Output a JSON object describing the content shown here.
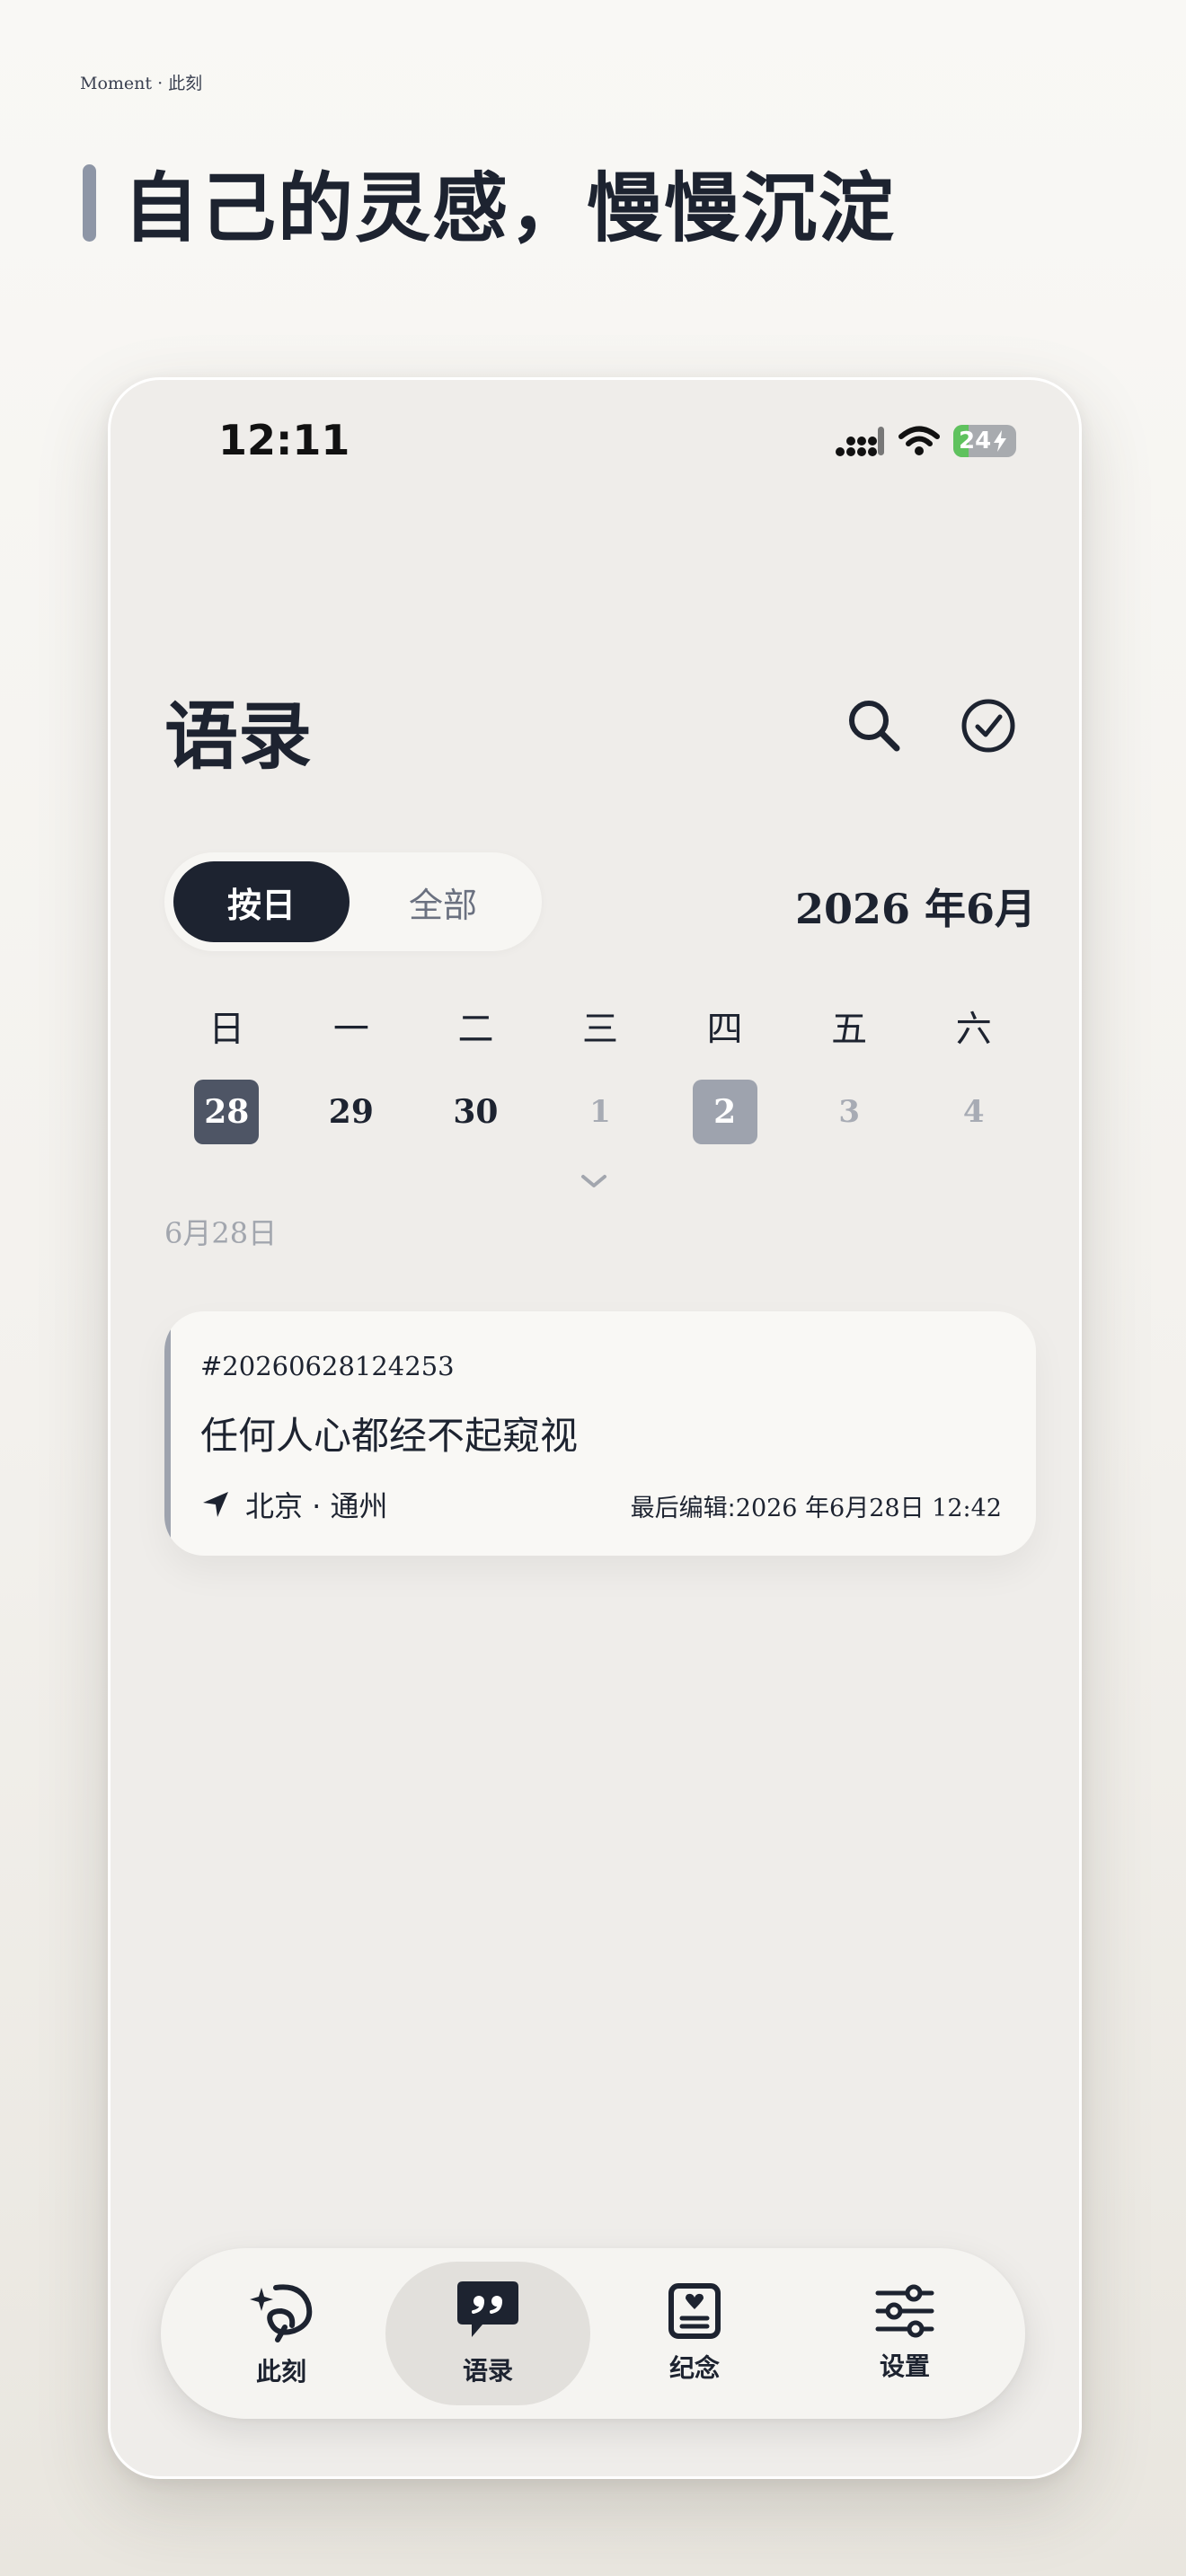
{
  "page": {
    "brand": "Moment · 此刻",
    "headline": "自己的灵感，慢慢沉淀"
  },
  "status_bar": {
    "time": "12:11",
    "battery": "24",
    "battery_fraction": 0.24
  },
  "header": {
    "title": "语录",
    "search_icon": "search-icon",
    "select_icon": "check-circle-icon"
  },
  "segment": {
    "by_day": "按日",
    "all": "全部",
    "active": "按日"
  },
  "calendar": {
    "month_label": "2026 年6月",
    "weekdays": [
      "日",
      "一",
      "二",
      "三",
      "四",
      "五",
      "六"
    ],
    "days": [
      {
        "label": "28",
        "state": "selected"
      },
      {
        "label": "29",
        "state": "past"
      },
      {
        "label": "30",
        "state": "past"
      },
      {
        "label": "1",
        "state": "future"
      },
      {
        "label": "2",
        "state": "today"
      },
      {
        "label": "3",
        "state": "future"
      },
      {
        "label": "4",
        "state": "future"
      }
    ],
    "selected_date": "6月28日"
  },
  "entries": [
    {
      "id": "#20260628124253",
      "text": "任何人心都经不起窥视",
      "location": "北京 · 通州",
      "edit_prefix": "最后编辑:",
      "edit_time": "2026  年6月28日 12:42"
    }
  ],
  "tabbar": {
    "tabs": [
      {
        "label": "此刻",
        "icon": "sparkle-icon"
      },
      {
        "label": "语录",
        "icon": "quote-bubble-icon",
        "active": true
      },
      {
        "label": "纪念",
        "icon": "memorial-card-icon"
      },
      {
        "label": "设置",
        "icon": "sliders-icon"
      }
    ]
  },
  "colors": {
    "primary": "#1d2330",
    "accent_gray": "#9ea3ae",
    "battery_green": "#5fc25e"
  }
}
